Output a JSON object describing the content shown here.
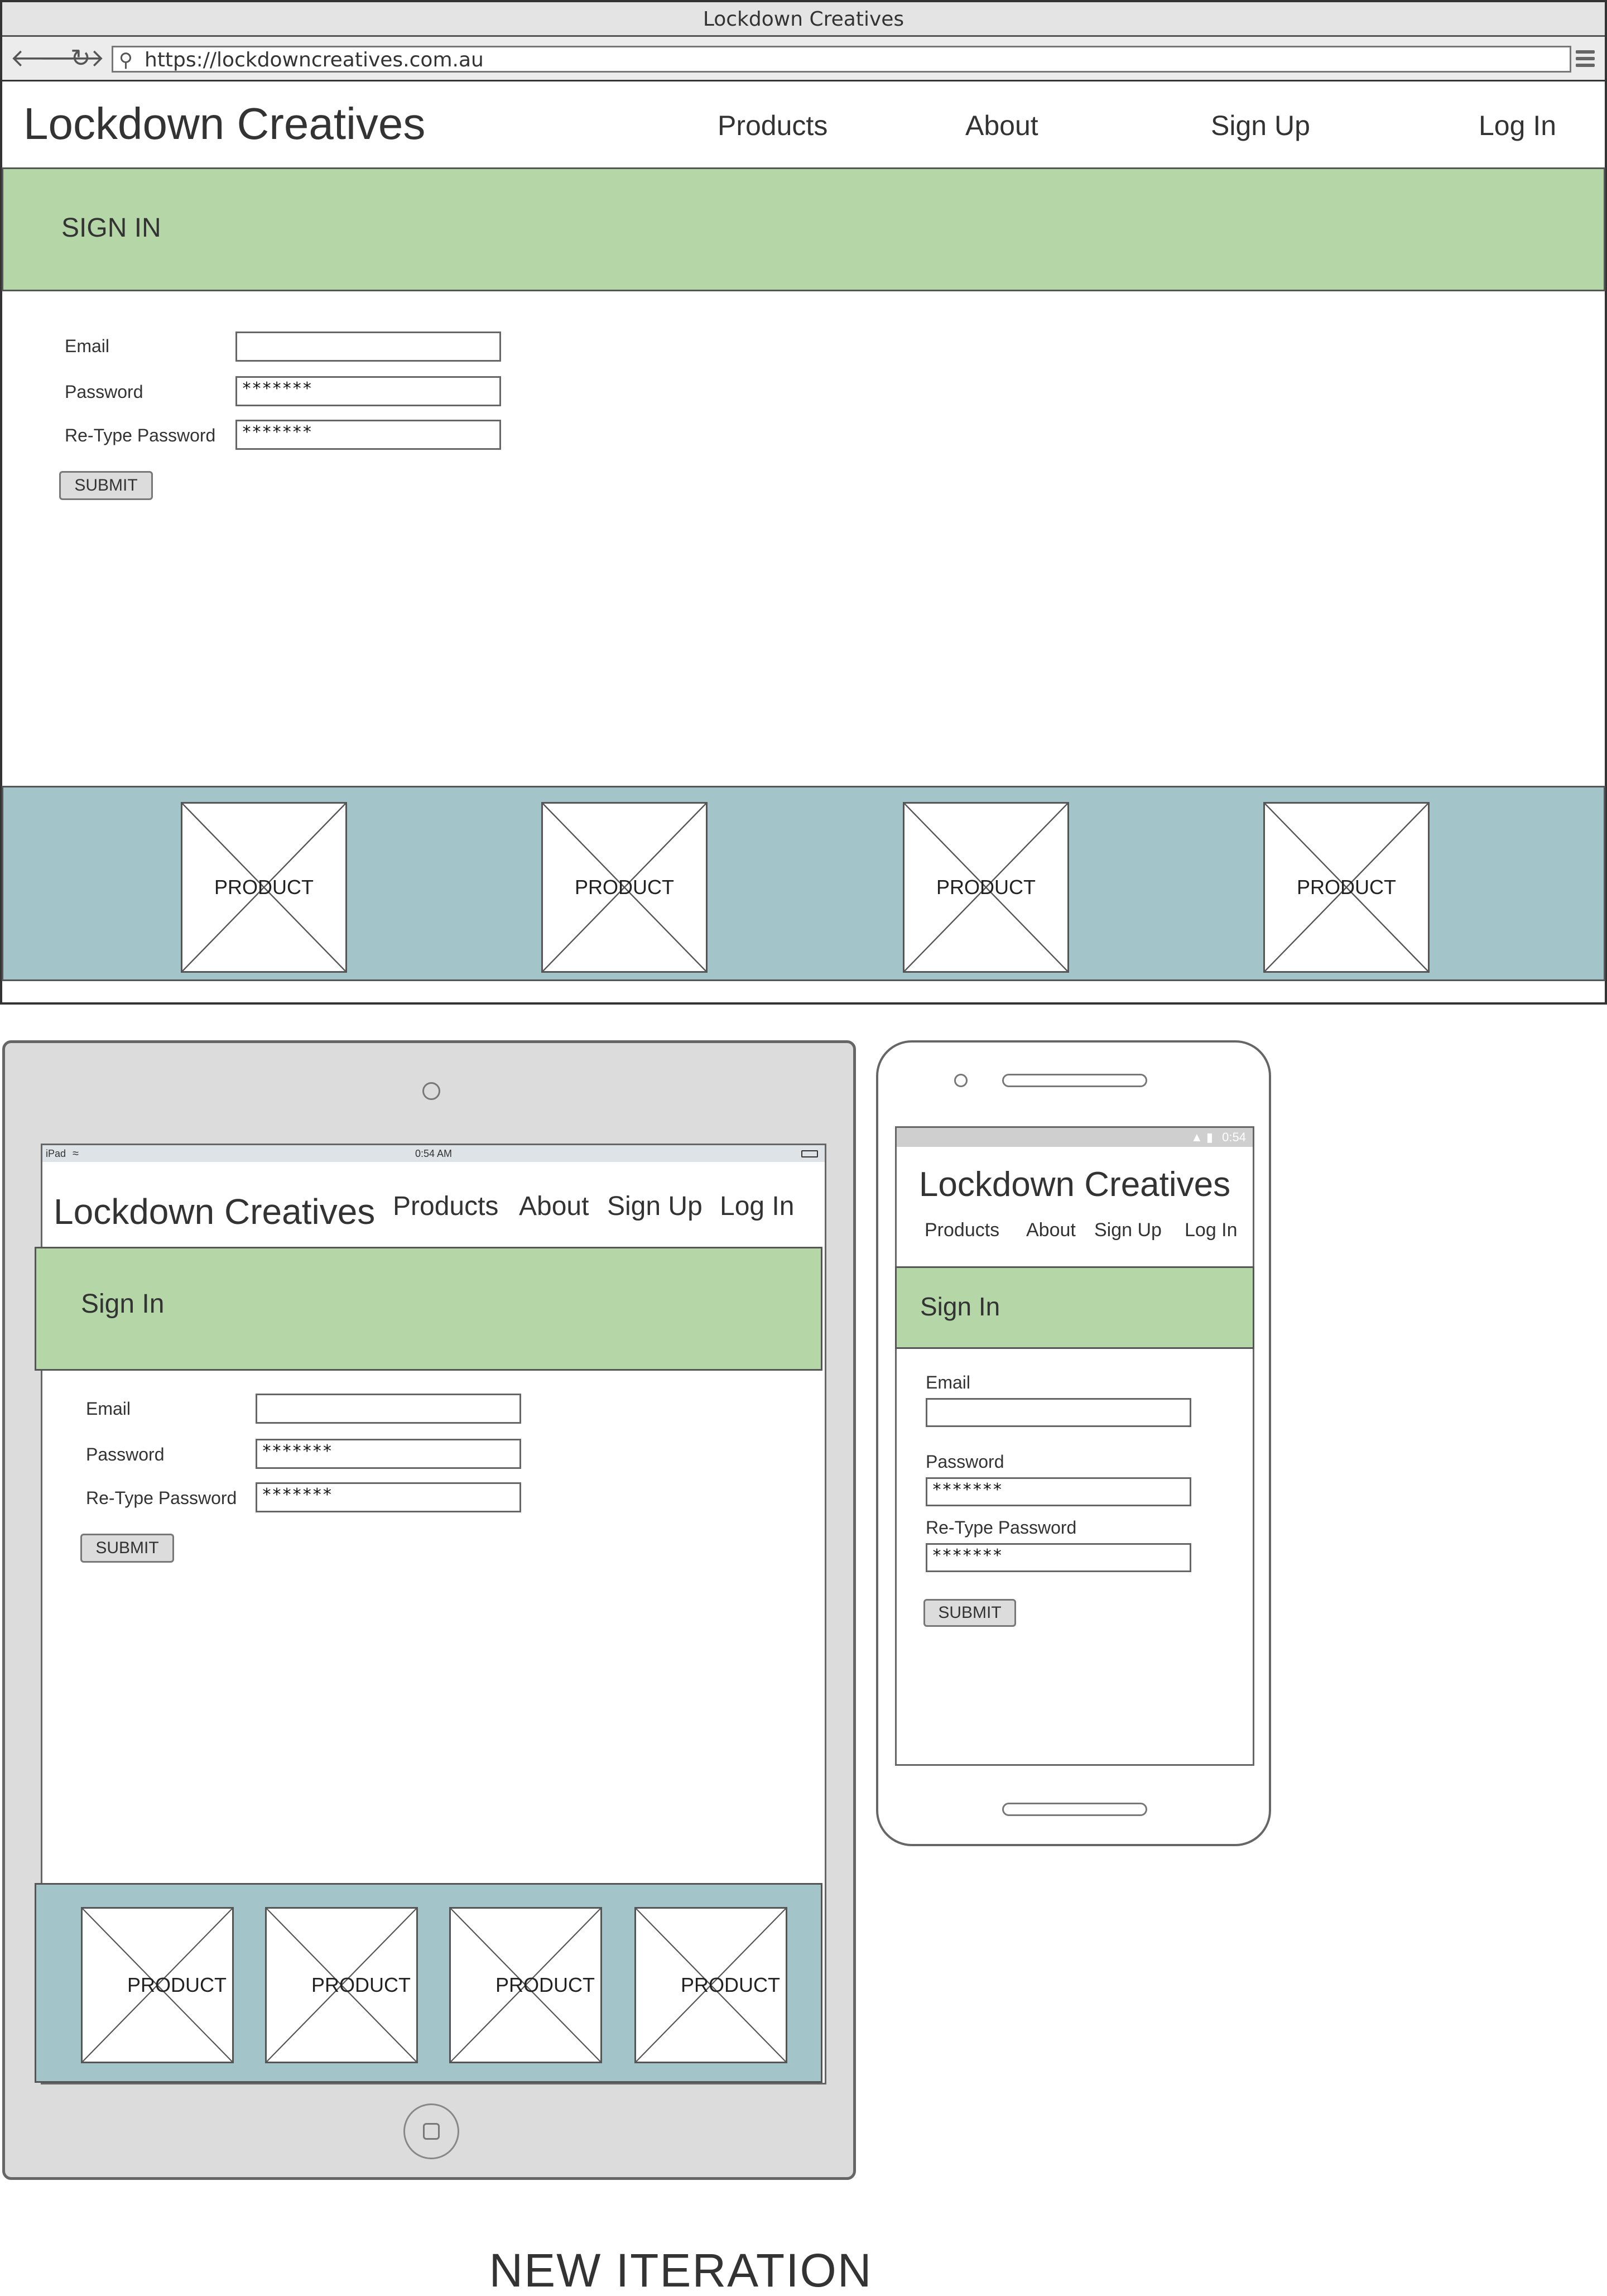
{
  "browser": {
    "window_title": "Lockdown Creatives",
    "url": "https://lockdowncreatives.com.au",
    "back_icon": "back-arrow-icon",
    "forward_icon": "forward-arrow-icon",
    "reload_icon": "reload-icon",
    "menu_icon": "hamburger-menu-icon"
  },
  "desktop": {
    "brand": "Lockdown Creatives",
    "nav": [
      "Products",
      "About",
      "Sign Up",
      "Log In"
    ],
    "banner_title": "SIGN IN",
    "form": {
      "email_label": "Email",
      "email_value": "",
      "password_label": "Password",
      "password_value": "*******",
      "retype_label": "Re-Type Password",
      "retype_value": "*******",
      "submit_label": "SUBMIT"
    },
    "products": [
      "PRODUCT",
      "PRODUCT",
      "PRODUCT",
      "PRODUCT"
    ]
  },
  "tablet": {
    "status_device": "iPad",
    "status_time": "0:54 AM",
    "brand": "Lockdown Creatives",
    "nav": [
      "Products",
      "About",
      "Sign Up",
      "Log In"
    ],
    "banner_title": "Sign In",
    "form": {
      "email_label": "Email",
      "email_value": "",
      "password_label": "Password",
      "password_value": "*******",
      "retype_label": "Re-Type Password",
      "retype_value": "*******",
      "submit_label": "SUBMIT"
    },
    "products": [
      "PRODUCT",
      "PRODUCT",
      "PRODUCT",
      "PRODUCT"
    ]
  },
  "phone": {
    "status_time": "0:54",
    "brand": "Lockdown Creatives",
    "nav": [
      "Products",
      "About",
      "Sign Up",
      "Log In"
    ],
    "banner_title": "Sign In",
    "form": {
      "email_label": "Email",
      "email_value": "",
      "password_label": "Password",
      "password_value": "*******",
      "retype_label": "Re-Type Password",
      "retype_value": "*******",
      "submit_label": "SUBMIT"
    }
  },
  "caption": "NEW ITERATION",
  "colors": {
    "banner_green": "#b5d7a8",
    "footer_teal": "#a3c5c9",
    "device_grey": "#dcdcdc"
  }
}
